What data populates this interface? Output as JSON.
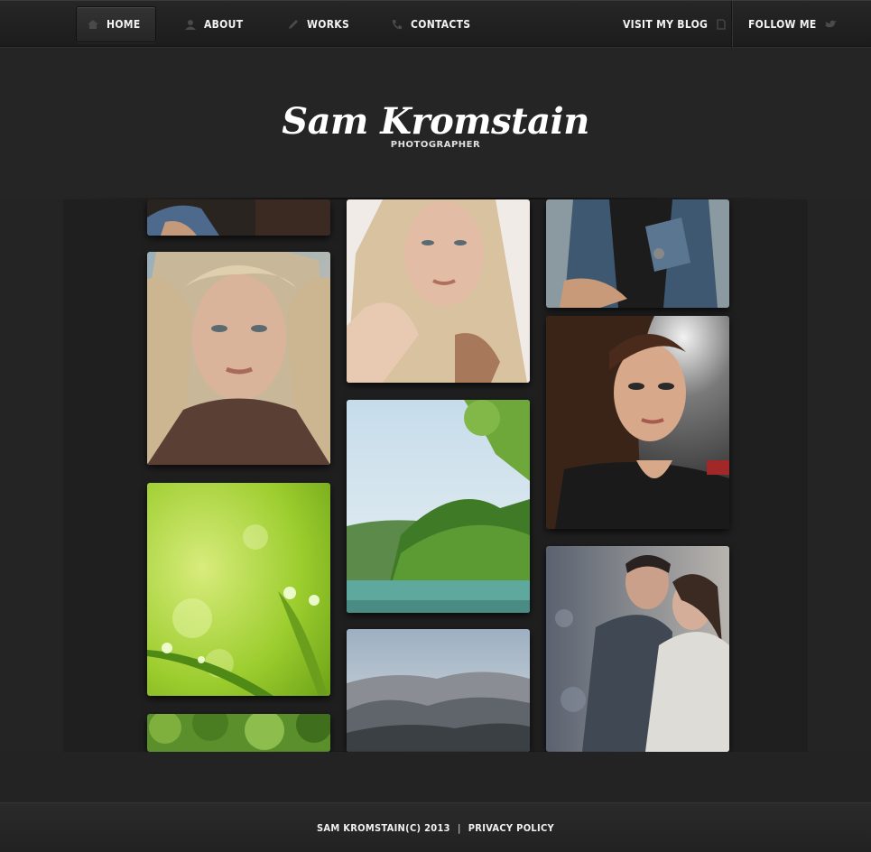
{
  "nav": {
    "items": [
      {
        "label": "HOME",
        "icon": "home-icon",
        "active": true
      },
      {
        "label": "ABOUT",
        "icon": "user-icon",
        "active": false
      },
      {
        "label": "WORKS",
        "icon": "pencil-icon",
        "active": false
      },
      {
        "label": "CONTACTS",
        "icon": "phone-icon",
        "active": false
      }
    ],
    "blog_label": "VISIT MY BLOG",
    "follow_label": "FOLLOW ME"
  },
  "header": {
    "name": "Sam Kromstain",
    "tagline": "PHOTOGRAPHER"
  },
  "footer": {
    "copyright": "SAM KROMSTAIN(C) 2013",
    "separator": "|",
    "privacy": "PRIVACY POLICY"
  },
  "colors": {
    "background": "#242424",
    "nav": "#1f1f1f",
    "text": "#f2f2f2"
  }
}
